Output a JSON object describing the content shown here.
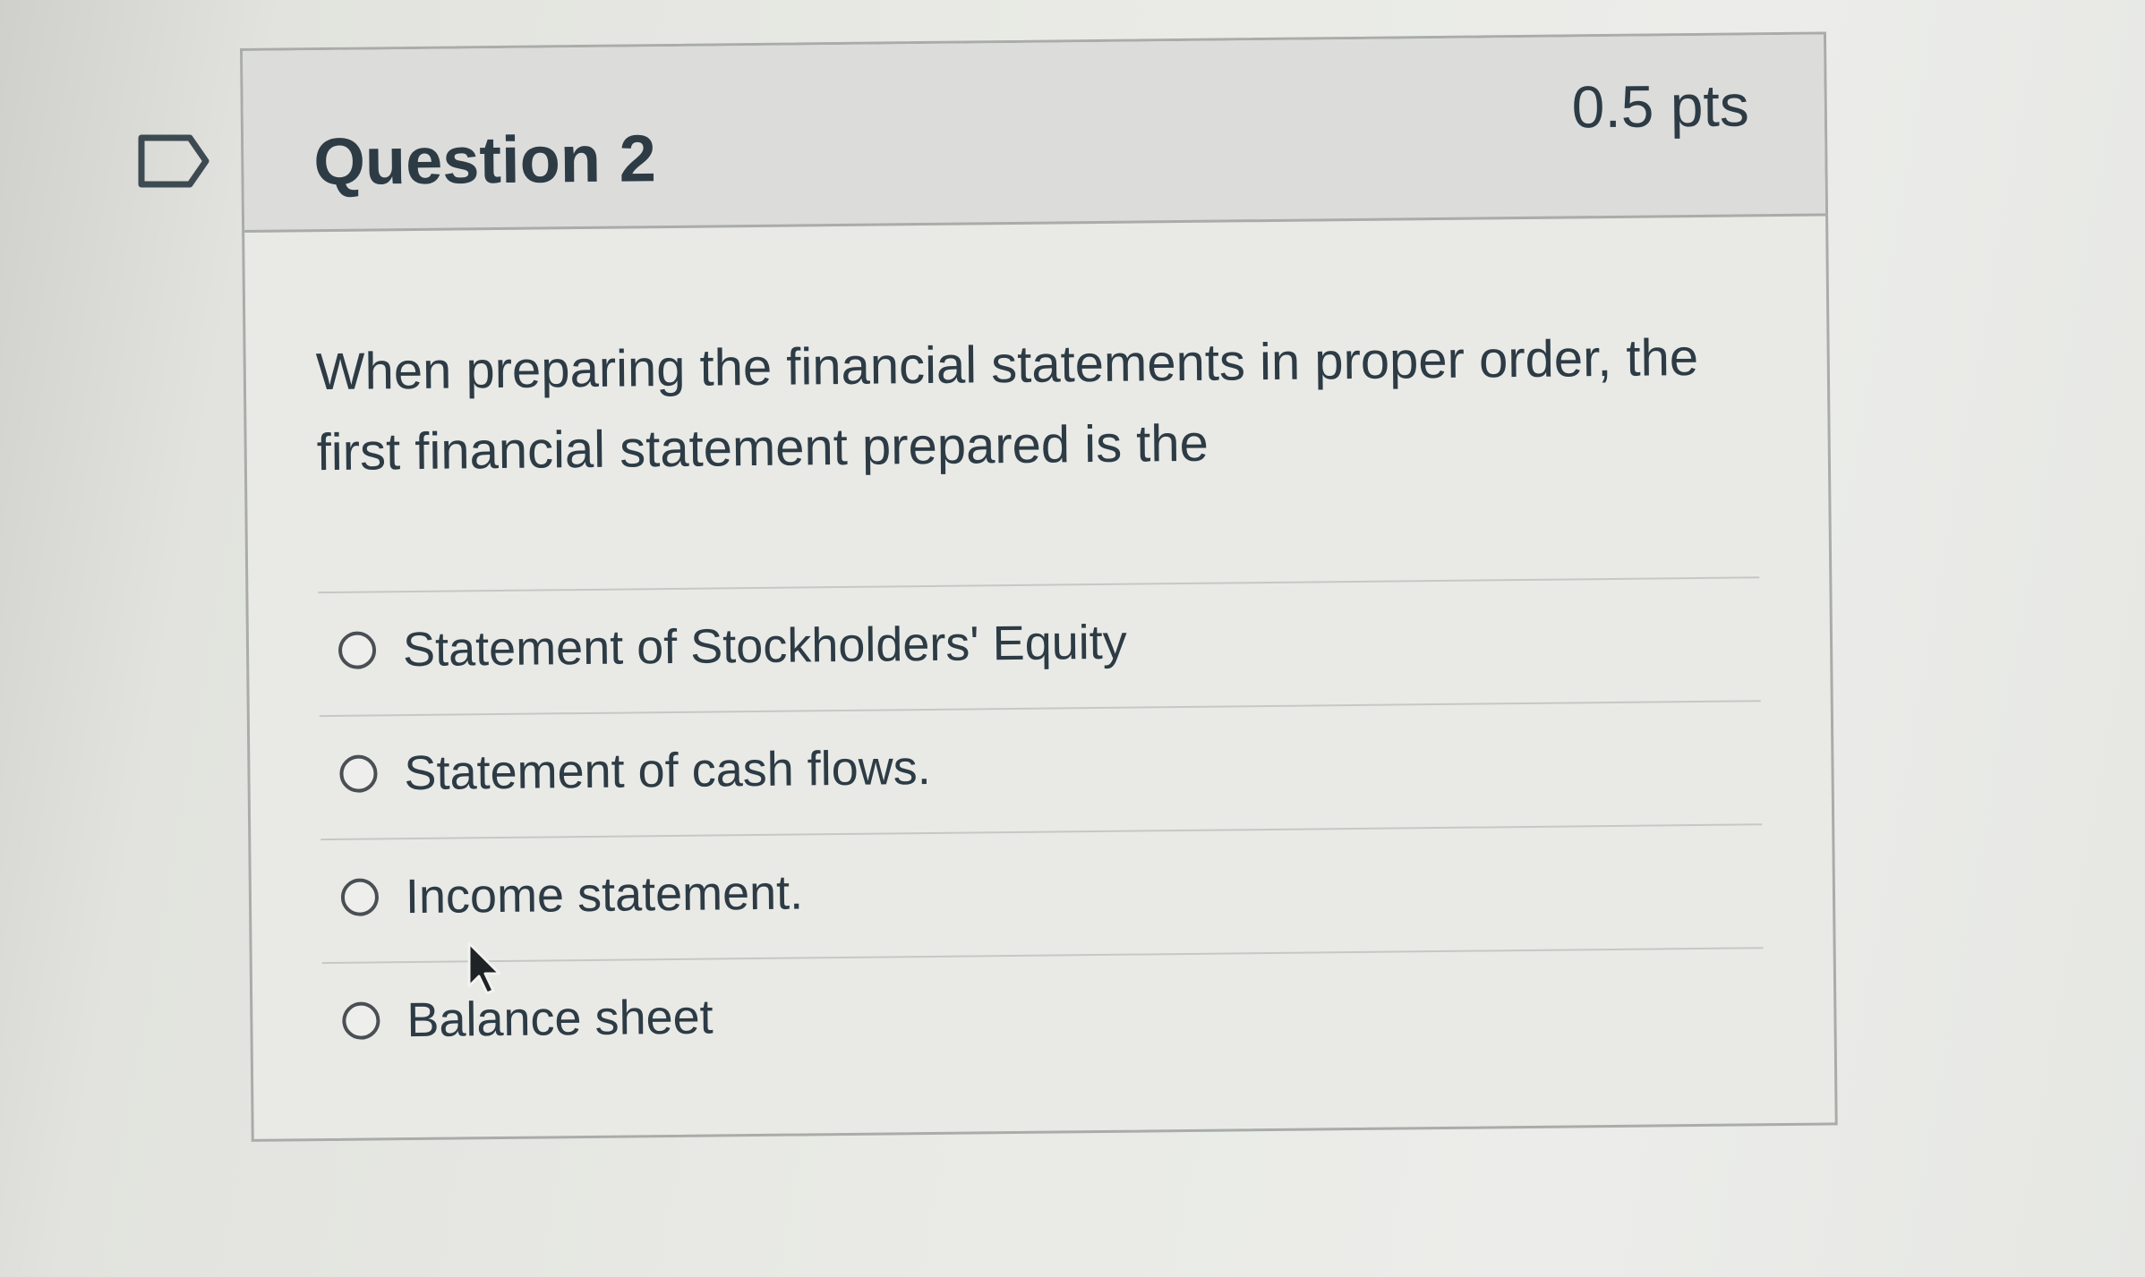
{
  "question": {
    "title": "Question 2",
    "points": "0.5 pts",
    "text": "When preparing the financial statements in proper order, the first financial statement prepared is the",
    "answers": [
      {
        "label": "Statement of Stockholders' Equity",
        "selected": false
      },
      {
        "label": "Statement of cash flows.",
        "selected": false
      },
      {
        "label": "Income statement.",
        "selected": false
      },
      {
        "label": "Balance sheet",
        "selected": false
      }
    ]
  },
  "icons": {
    "flag": "flag-icon",
    "cursor": "mouse-pointer-icon"
  },
  "colors": {
    "text": "#2d3b45",
    "header_bg": "#dcdddb",
    "border": "#a9aca9",
    "radio_border": "#4a4f54"
  }
}
